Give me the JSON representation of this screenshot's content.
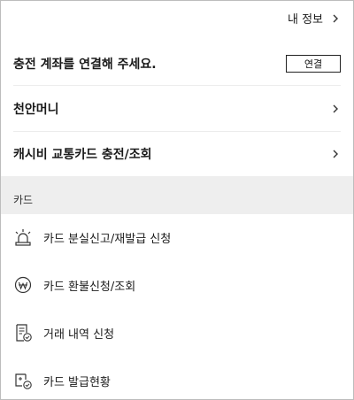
{
  "header": {
    "my_info_label": "내 정보"
  },
  "account": {
    "message": "충전 계좌를 연결해 주세요.",
    "connect_label": "연결"
  },
  "rows": [
    {
      "label": "천안머니"
    },
    {
      "label": "캐시비 교통카드 충전/조회"
    }
  ],
  "card_section": {
    "title": "카드",
    "items": [
      {
        "label": "카드 분실신고/재발급 신청",
        "icon": "siren-icon"
      },
      {
        "label": "카드 환불신청/조회",
        "icon": "won-coin-icon"
      },
      {
        "label": "거래 내역 신청",
        "icon": "receipt-check-icon"
      },
      {
        "label": "카드 발급현황",
        "icon": "card-check-icon"
      }
    ]
  }
}
